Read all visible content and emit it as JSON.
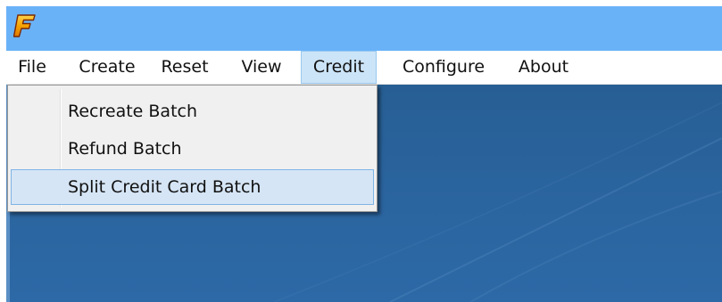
{
  "app": {
    "logo_letter": "F",
    "colors": {
      "titlebar": "#69b2f8",
      "desktop": "#2b65a0",
      "menu_active_bg": "#cce4f7",
      "menu_active_border": "#99c9ef",
      "dropdown_bg": "#f0f0f0",
      "highlight_bg": "#d5e5f5",
      "highlight_border": "#7fb4e6",
      "logo_fill": "#f5a300",
      "logo_outline": "#7a2800"
    }
  },
  "menubar": {
    "items": [
      {
        "label": "File"
      },
      {
        "label": "Create"
      },
      {
        "label": "Reset"
      },
      {
        "label": "View"
      },
      {
        "label": "Credit",
        "active": true
      },
      {
        "label": "Configure"
      },
      {
        "label": "About"
      }
    ]
  },
  "credit_menu": {
    "items": [
      {
        "label": "Recreate Batch"
      },
      {
        "label": "Refund Batch"
      },
      {
        "label": "Split Credit Card Batch",
        "highlighted": true
      }
    ]
  }
}
